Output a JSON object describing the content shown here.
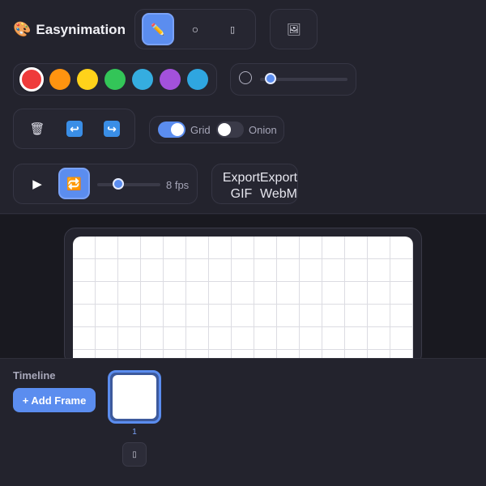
{
  "app": {
    "title": "Easynimation",
    "logo_emoji": "🎨"
  },
  "tools": {
    "pencil_icon": "✏️",
    "circle_icon": "○",
    "eraser_icon": "▯",
    "image_icon": "🖼",
    "active": "pencil"
  },
  "palette": {
    "colors": [
      "#ef3b3b",
      "#ff9410",
      "#ffd21a",
      "#33c558",
      "#35ade0",
      "#a351db",
      "#2fa6e0"
    ],
    "selected_index": 0
  },
  "brush": {
    "size_icon": "○",
    "size_level": 0.12
  },
  "actions": {
    "clear_icon": "🗑",
    "undo_icon": "↩",
    "redo_icon": "↪"
  },
  "toggles": {
    "grid": {
      "label": "Grid",
      "on": true
    },
    "onion": {
      "label": "Onion",
      "on": false
    }
  },
  "playback": {
    "play_icon": "▶",
    "loop_icon": "🔁",
    "fps_value": 8,
    "fps_label": "8 fps",
    "speed_level": 0.33
  },
  "export": {
    "gif_label": "Export\nGIF",
    "webm_label": "Export\nWebM"
  },
  "timeline": {
    "label": "Timeline",
    "add_frame": "+ Add Frame",
    "frames": [
      {
        "number": "1",
        "selected": true
      }
    ],
    "delete_icon": "▯"
  },
  "colors": {
    "accent": "#5b8def",
    "background": "#1f1f2a",
    "panel": "#262631"
  }
}
